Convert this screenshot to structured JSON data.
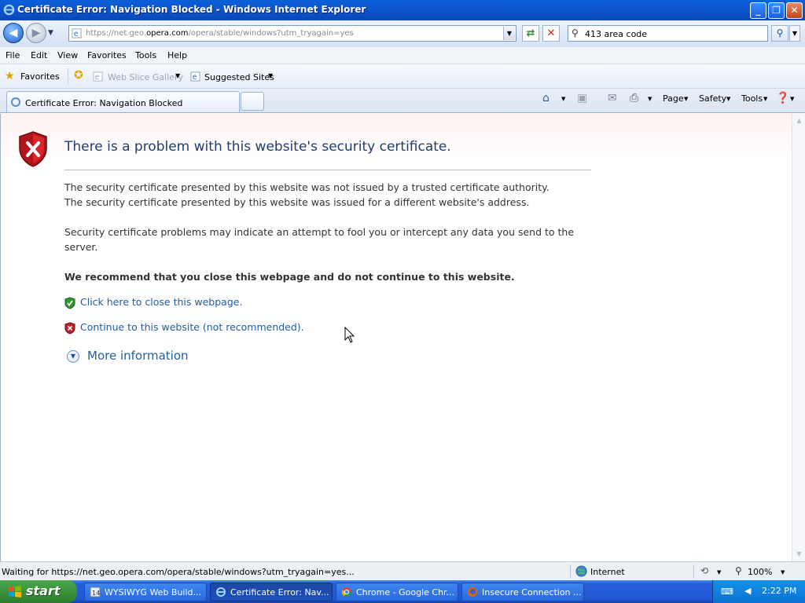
{
  "window": {
    "title": "Certificate Error: Navigation Blocked - Windows Internet Explorer",
    "minimize_icon": "minimize-icon",
    "maximize_icon": "restore-icon",
    "close_icon": "close-icon"
  },
  "address_bar": {
    "url_prefix": "https://net.geo.",
    "url_domain": "opera.com",
    "url_suffix": "/opera/stable/windows?utm_tryagain=yes"
  },
  "search": {
    "value": "413 area code"
  },
  "menu": {
    "items": [
      "File",
      "Edit",
      "View",
      "Favorites",
      "Tools",
      "Help"
    ]
  },
  "favorites_bar": {
    "favorites_label": "Favorites",
    "web_slice_label": "Web Slice Gallery",
    "suggested_label": "Suggested Sites"
  },
  "tabs": {
    "active_label": "Certificate Error: Navigation Blocked"
  },
  "command_bar": {
    "page_label": "Page",
    "safety_label": "Safety",
    "tools_label": "Tools"
  },
  "content": {
    "heading": "There is a problem with this website's security certificate.",
    "para1_line1": "The security certificate presented by this website was not issued by a trusted certificate authority.",
    "para1_line2": "The security certificate presented by this website was issued for a different website's address.",
    "para2": "Security certificate problems may indicate an attempt to fool you or intercept any data you send to the server.",
    "recommend": "We recommend that you close this webpage and do not continue to this website.",
    "close_link": "Click here to close this webpage.",
    "continue_link": "Continue to this website (not recommended).",
    "more_info": "More information"
  },
  "status_bar": {
    "text": "Waiting for https://net.geo.opera.com/opera/stable/windows?utm_tryagain=yes...",
    "zone": "Internet",
    "zoom": "100%"
  },
  "taskbar": {
    "start_label": "start",
    "items": [
      {
        "label": "WYSIWYG Web Build...",
        "icon": "wysiwyg-app-icon"
      },
      {
        "label": "Certificate Error: Nav...",
        "icon": "ie-icon"
      },
      {
        "label": "Chrome - Google Chr...",
        "icon": "chrome-icon"
      },
      {
        "label": "Insecure Connection ...",
        "icon": "firefox-icon"
      }
    ],
    "clock": "2:22 PM"
  },
  "colors": {
    "title_bar": "#0a5fd8",
    "link": "#1f5ea3",
    "heading": "#1f3d6d",
    "taskbar": "#245edb",
    "start_button": "#3a913a"
  }
}
